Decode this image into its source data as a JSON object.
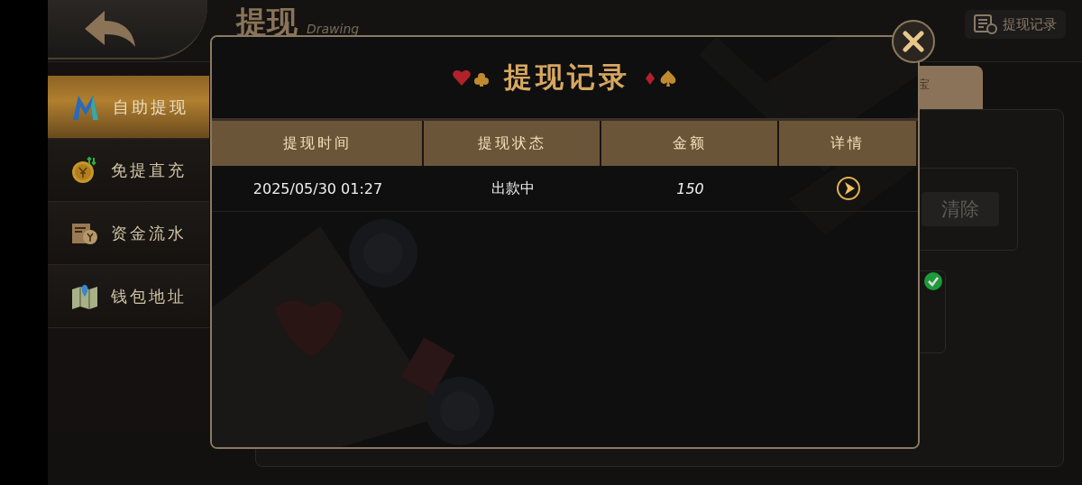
{
  "header": {
    "title": "提现",
    "subtitle": "Drawing",
    "records_button": "提现记录"
  },
  "sidebar": {
    "items": [
      {
        "label": "自助提现",
        "selected": true
      },
      {
        "label": "免提直充",
        "selected": false
      },
      {
        "label": "资金流水",
        "selected": false
      },
      {
        "label": "钱包地址",
        "selected": false
      }
    ]
  },
  "panel": {
    "tab": "宝",
    "clear_button": "清除",
    "checked": true
  },
  "dialog": {
    "title": "提现记录",
    "columns": [
      "提现时间",
      "提现状态",
      "金额",
      "详情"
    ],
    "rows": [
      {
        "time": "2025/05/30 01:27",
        "status": "出款中",
        "amount": "150"
      }
    ]
  }
}
